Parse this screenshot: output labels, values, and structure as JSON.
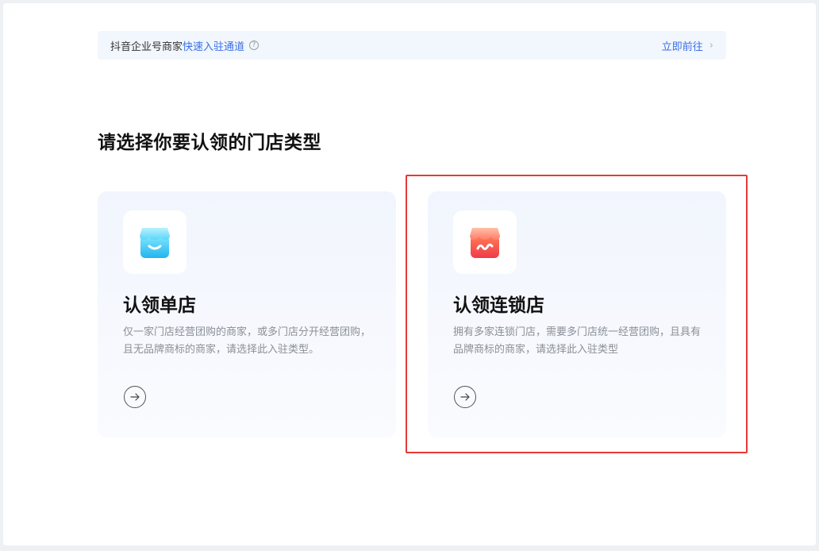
{
  "banner": {
    "prefix": "抖音企业号商家",
    "link": "快速入驻通道",
    "action": "立即前往"
  },
  "heading": "请选择你要认领的门店类型",
  "cards": [
    {
      "title": "认领单店",
      "desc": "仅一家门店经营团购的商家，或多门店分开经营团购，且无品牌商标的商家，请选择此入驻类型。",
      "icon": "store-icon",
      "icon_color": "#3cc7f2"
    },
    {
      "title": "认领连锁店",
      "desc": "拥有多家连锁门店，需要多门店统一经营团购，且具有品牌商标的商家，请选择此入驻类型",
      "icon": "chain-store-icon",
      "icon_color": "#f2544a"
    }
  ],
  "colors": {
    "link": "#3a6fe5",
    "highlight": "#e53935"
  }
}
